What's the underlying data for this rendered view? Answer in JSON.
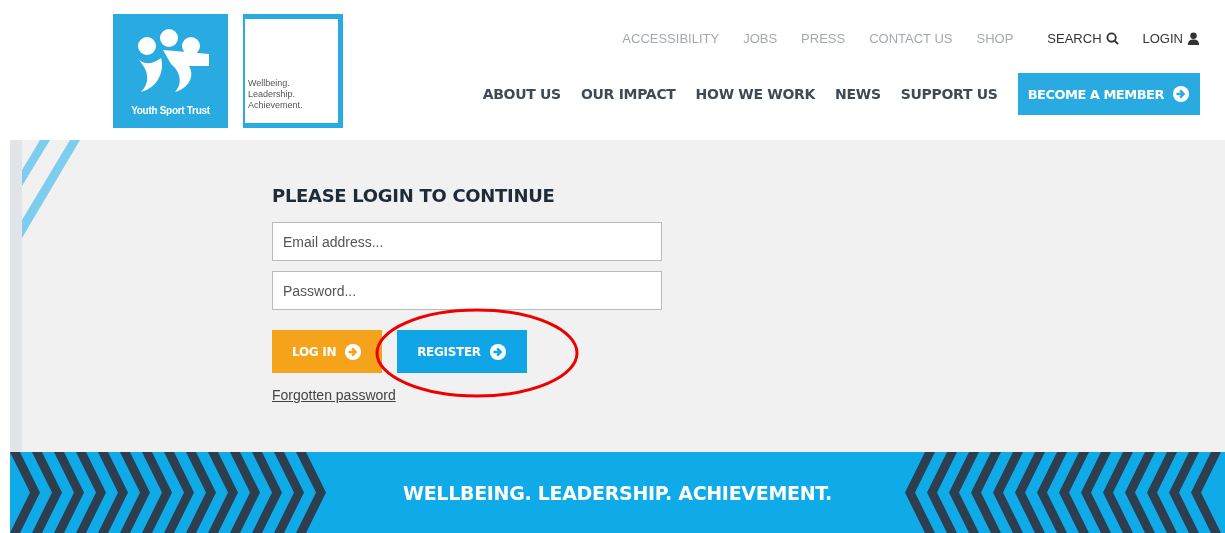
{
  "logo": {
    "name": "Youth Sport Trust",
    "tagline": [
      "Wellbeing.",
      "Leadership.",
      "Achievement."
    ]
  },
  "utility_nav": [
    {
      "label": "ACCESSIBILITY",
      "kind": "link"
    },
    {
      "label": "JOBS",
      "kind": "link"
    },
    {
      "label": "PRESS",
      "kind": "link"
    },
    {
      "label": "CONTACT US",
      "kind": "link"
    },
    {
      "label": "SHOP",
      "kind": "link"
    },
    {
      "label": "SEARCH",
      "kind": "search"
    },
    {
      "label": "LOGIN",
      "kind": "login"
    }
  ],
  "main_nav": [
    "ABOUT US",
    "OUR IMPACT",
    "HOW WE WORK",
    "NEWS",
    "SUPPORT US"
  ],
  "cta": {
    "label": "BECOME A MEMBER"
  },
  "login_form": {
    "title": "PLEASE LOGIN TO CONTINUE",
    "email": {
      "placeholder": "Email address..."
    },
    "password": {
      "placeholder": "Password..."
    },
    "buttons": [
      {
        "label": "LOG IN",
        "kind": "login"
      },
      {
        "label": "REGISTER",
        "kind": "register",
        "highlighted": true
      }
    ],
    "forgot_link": "Forgotten password"
  },
  "banner": {
    "text": "WELLBEING. LEADERSHIP. ACHIEVEMENT."
  }
}
